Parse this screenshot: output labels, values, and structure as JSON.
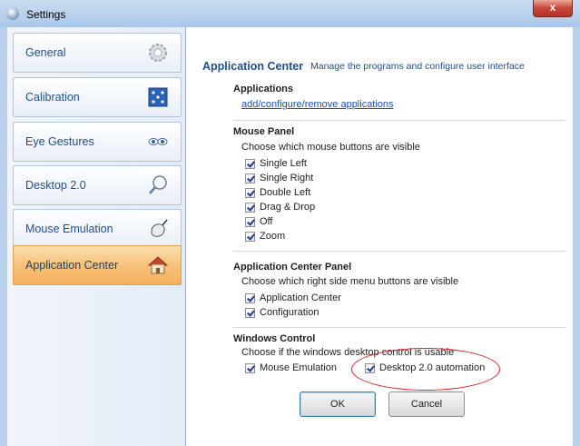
{
  "window": {
    "title": "Settings",
    "close_glyph": "x"
  },
  "sidebar": {
    "items": [
      {
        "label": "General",
        "icon": "gear-icon"
      },
      {
        "label": "Calibration",
        "icon": "calibration-icon"
      },
      {
        "label": "Eye Gestures",
        "icon": "eyes-icon"
      },
      {
        "label": "Desktop 2.0",
        "icon": "magnifier-icon"
      },
      {
        "label": "Mouse Emulation",
        "icon": "mouse-icon"
      },
      {
        "label": "Application Center",
        "icon": "home-icon",
        "selected": true
      }
    ]
  },
  "header": {
    "title": "Application Center",
    "description": "Manage the programs and configure user interface"
  },
  "applications": {
    "title": "Applications",
    "link": "add/configure/remove applications"
  },
  "mouse_panel": {
    "title": "Mouse Panel",
    "description": "Choose which mouse buttons are visible",
    "options": [
      {
        "label": "Single Left",
        "checked": true
      },
      {
        "label": "Single Right",
        "checked": true
      },
      {
        "label": "Double Left",
        "checked": true
      },
      {
        "label": "Drag & Drop",
        "checked": true
      },
      {
        "label": "Off",
        "checked": true
      },
      {
        "label": "Zoom",
        "checked": true
      }
    ]
  },
  "app_center_panel": {
    "title": "Application Center Panel",
    "description": "Choose which right side menu buttons are visible",
    "options": [
      {
        "label": "Application Center",
        "checked": true
      },
      {
        "label": "Configuration",
        "checked": true
      }
    ]
  },
  "windows_control": {
    "title": "Windows Control",
    "description": "Choose if the windows desktop control is usable",
    "options": [
      {
        "label": "Mouse Emulation",
        "checked": true
      },
      {
        "label": "Desktop 2.0 automation",
        "checked": true
      }
    ]
  },
  "buttons": {
    "ok": "OK",
    "cancel": "Cancel"
  },
  "colors": {
    "accent_text": "#1f4f8a",
    "selected_item": "#f7c27a",
    "annotation": "#d42020"
  }
}
